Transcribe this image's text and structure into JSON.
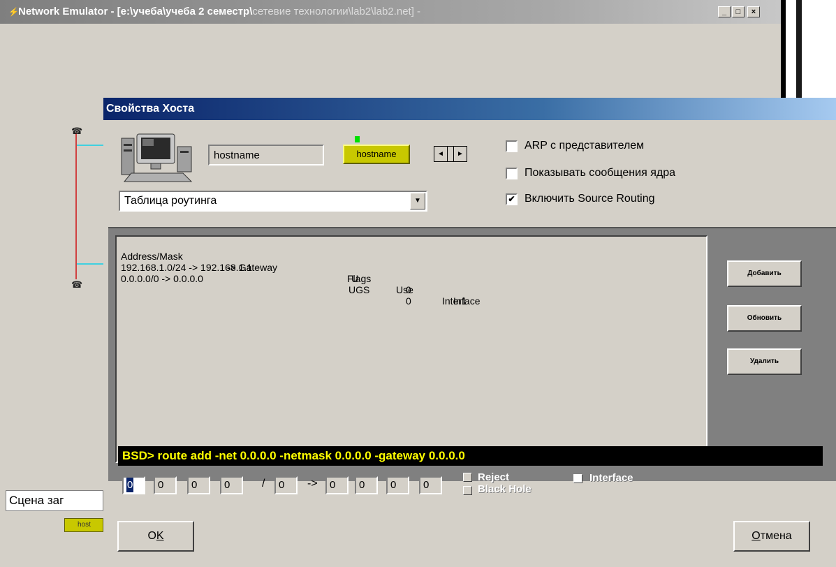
{
  "app": {
    "title": "Network Emulator - [e:\\учеба\\учеба 2 семестр\\",
    "title_dim": "сетевие технологии\\lab2\\lab2.net] -",
    "min_glyph": "_",
    "max_glyph": "□",
    "close_glyph": "×",
    "scene_label": "Сцена заг",
    "host_chip_bg": "host"
  },
  "dialog": {
    "title": "Свойства Хоста",
    "hostname_value": "hostname",
    "host_chip": "hostname",
    "spin_left": "◄",
    "spin_right": "►",
    "options": [
      {
        "label": "ARP с представителем",
        "checked": false
      },
      {
        "label": "Показывать сообщения ядра",
        "checked": false
      },
      {
        "label": "Включить Source Routing",
        "checked": true
      }
    ],
    "view_select": "Таблица роутинга",
    "routes": {
      "headers": {
        "addr": "Address/Mask",
        "gw": "-> Gateway",
        "flags": "Flags",
        "use": "Use",
        "iface": "Interface"
      },
      "rows": [
        {
          "route": "192.168.1.0/24 -> 192.168.1.1",
          "flags": "U",
          "use": "0",
          "iface": "In1"
        },
        {
          "route": "0.0.0.0/0 -> 0.0.0.0",
          "flags": "UGS",
          "use": "0",
          "iface": ""
        }
      ]
    },
    "side_buttons": {
      "add": "Добавить",
      "update": "Обновить",
      "delete": "Удалить"
    },
    "command": "BSD> route add -net 0.0.0.0 -netmask 0.0.0.0 -gateway 0.0.0.0",
    "ip": {
      "net": [
        "0",
        "0",
        "0",
        "0"
      ],
      "mask": "0",
      "gw": [
        "0",
        "0",
        "0",
        "0"
      ],
      "slash": "/",
      "arrow": "->"
    },
    "flags": {
      "reject": "Reject",
      "blackhole": "Black Hole",
      "interface": "Interface"
    },
    "ok_label": "OK",
    "ok_underline": "K",
    "ok_prefix": "O",
    "cancel_label_rest": "тмена",
    "cancel_label_ul": "О"
  }
}
